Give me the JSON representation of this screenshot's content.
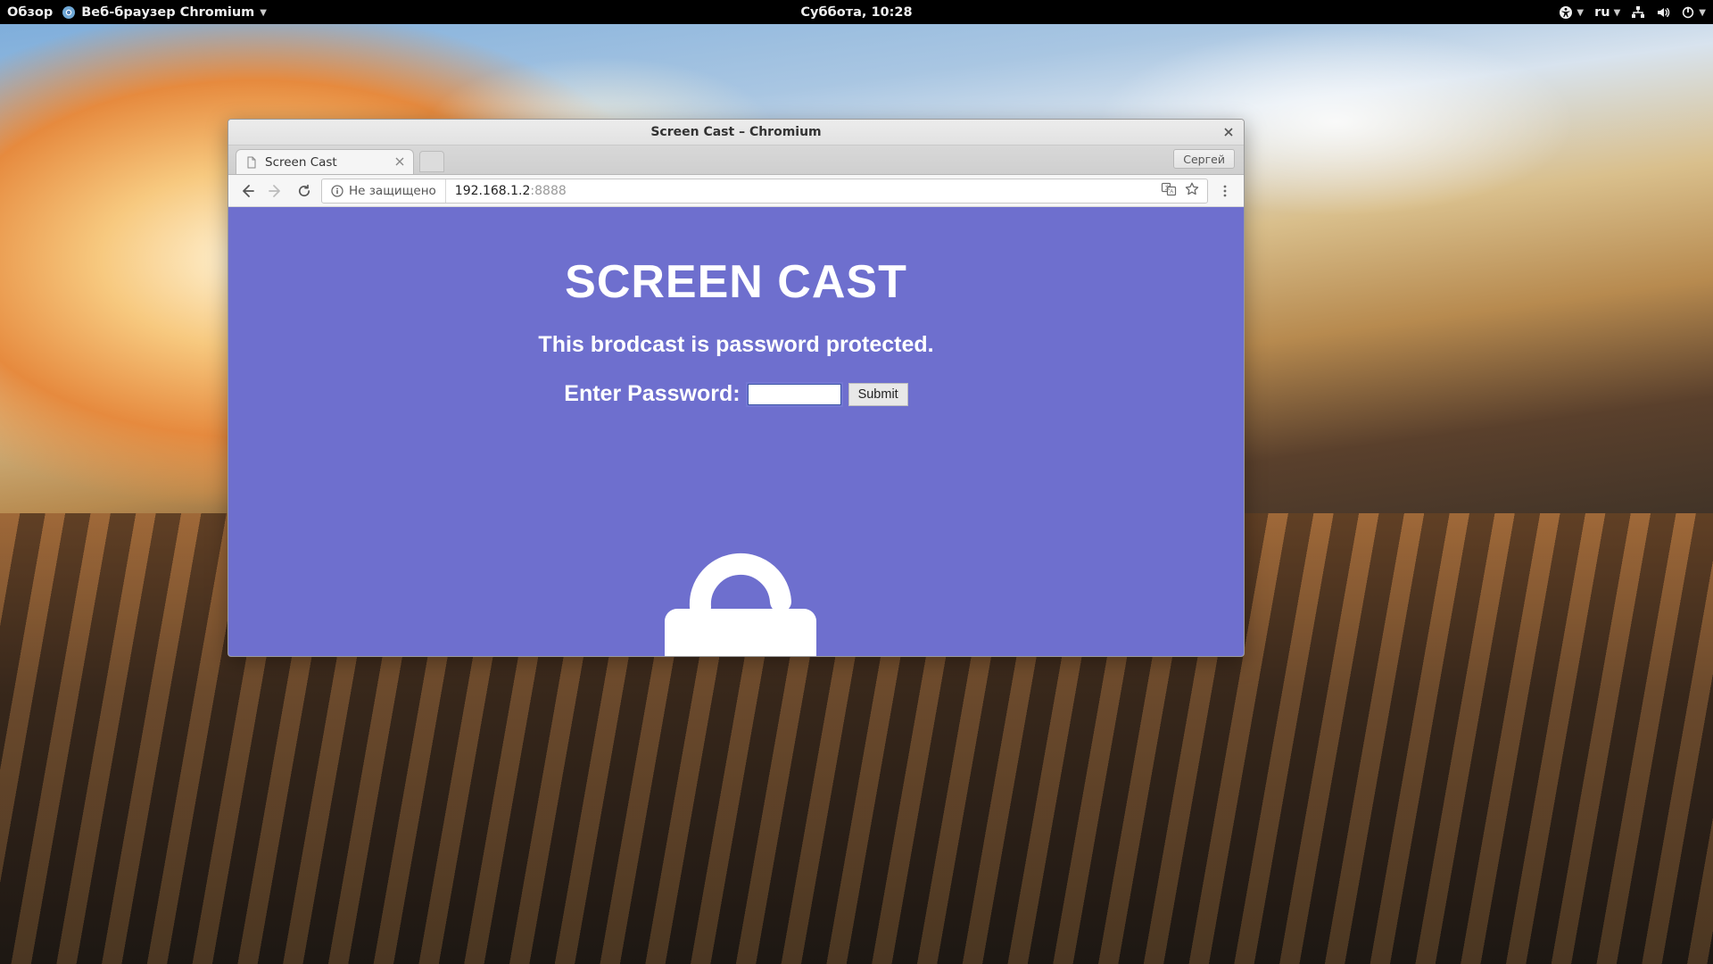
{
  "topbar": {
    "activities": "Обзор",
    "app_name": "Веб-браузер Chromium",
    "clock": "Суббота, 10:28",
    "lang": "ru"
  },
  "window": {
    "title": "Screen Cast – Chromium",
    "tab_title": "Screen Cast",
    "profile": "Сергей",
    "security_label": "Не защищено",
    "url_main": "192.168.1.2",
    "url_port": ":8888"
  },
  "page": {
    "heading": "SCREEN CAST",
    "sub": "This brodcast is password protected.",
    "pw_label": "Enter Password:",
    "submit": "Submit"
  }
}
